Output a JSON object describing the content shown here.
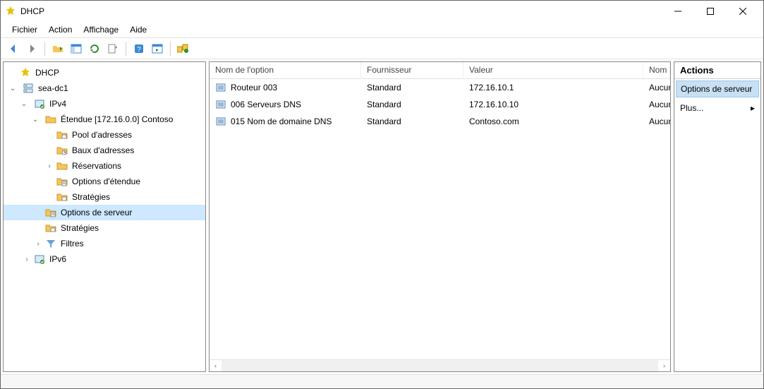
{
  "window": {
    "title": "DHCP"
  },
  "menu": {
    "file": "Fichier",
    "action": "Action",
    "view": "Affichage",
    "help": "Aide"
  },
  "tree": {
    "root": "DHCP",
    "server": "sea-dc1",
    "ipv4": "IPv4",
    "ipv6": "IPv6",
    "scope": "Étendue [172.16.0.0] Contoso",
    "pool": "Pool d'adresses",
    "leases": "Baux d'adresses",
    "reservations": "Réservations",
    "scope_options": "Options d'étendue",
    "scope_strategies": "Stratégies",
    "server_options": "Options de serveur",
    "server_strategies": "Stratégies",
    "filters": "Filtres"
  },
  "list": {
    "headers": {
      "name": "Nom de l'option",
      "vendor": "Fournisseur",
      "value": "Valeur",
      "strategy": "Nom de la str"
    },
    "rows": [
      {
        "name": "Routeur 003",
        "vendor": "Standard",
        "value": "172.16.10.1",
        "strategy": "Aucune"
      },
      {
        "name": "006 Serveurs DNS",
        "vendor": "Standard",
        "value": "172.16.10.10",
        "strategy": "Aucune"
      },
      {
        "name": "015 Nom de domaine DNS",
        "vendor": "Standard",
        "value": "Contoso.com",
        "strategy": "Aucune"
      }
    ]
  },
  "actions": {
    "header": "Actions",
    "selected": "Options de serveur",
    "more": "Plus..."
  }
}
